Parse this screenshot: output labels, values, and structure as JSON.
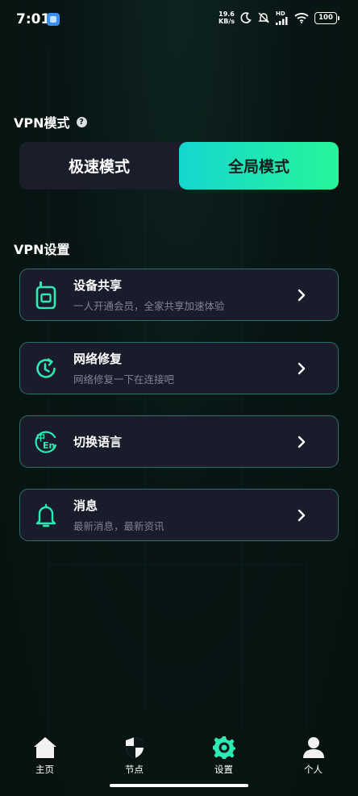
{
  "status_bar": {
    "time": "7:01",
    "net_speed_value": "19.6",
    "net_speed_unit": "KB/s",
    "network_label": "HD",
    "battery": "100",
    "icons": [
      "app-icon",
      "moon-icon",
      "alarm-off-icon",
      "signal-icon",
      "wifi-icon",
      "battery-icon"
    ]
  },
  "vpn_mode": {
    "title": "VPN模式",
    "help_glyph": "?",
    "options": [
      {
        "label": "极速模式",
        "active": false
      },
      {
        "label": "全局模式",
        "active": true
      }
    ]
  },
  "vpn_settings": {
    "title": "VPN设置",
    "items": [
      {
        "title": "设备共享",
        "subtitle": "一人开通会员，全家共享加速体验",
        "icon": "device-share-icon"
      },
      {
        "title": "网络修复",
        "subtitle": "网络修复一下在连接吧",
        "icon": "network-repair-icon"
      },
      {
        "title": "切换语言",
        "subtitle": "",
        "icon": "language-icon",
        "icon_text_top": "中",
        "icon_text_bottom": "En"
      },
      {
        "title": "消息",
        "subtitle": "最新消息，最新资讯",
        "icon": "bell-icon"
      }
    ]
  },
  "bottom_nav": {
    "items": [
      {
        "label": "主页",
        "icon": "home-icon",
        "active": false
      },
      {
        "label": "节点",
        "icon": "shield-icon",
        "active": false
      },
      {
        "label": "设置",
        "icon": "gear-icon",
        "active": true
      },
      {
        "label": "个人",
        "icon": "person-icon",
        "active": false
      }
    ]
  },
  "colors": {
    "accent_start": "#16d6cf",
    "accent_end": "#27f59a",
    "icon_accent": "#2ee8b6",
    "card_bg": "#1a1c2b",
    "card_border": "#2f6f66"
  }
}
